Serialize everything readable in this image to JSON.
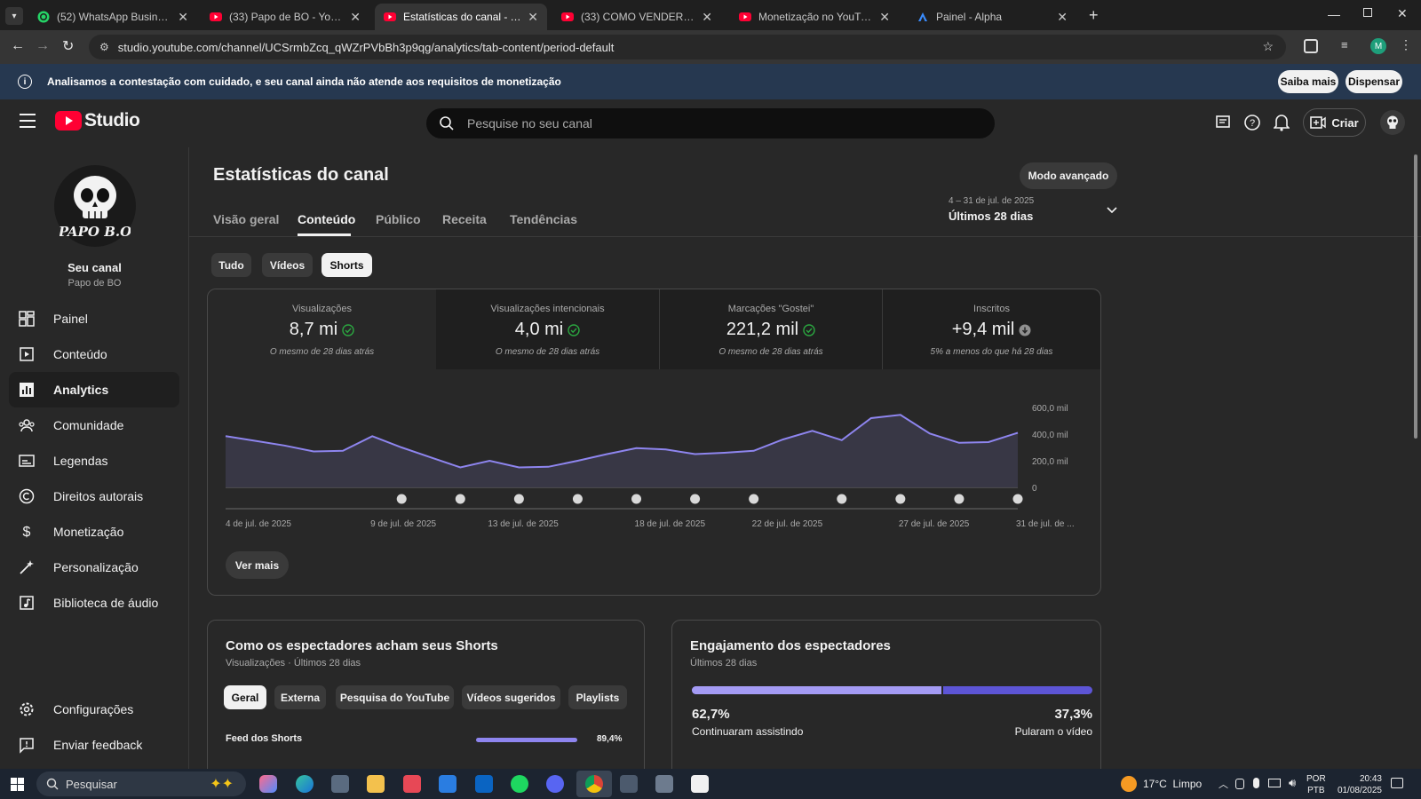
{
  "browser": {
    "tabs": [
      {
        "title": "(52) WhatsApp Business",
        "active": false
      },
      {
        "title": "(33) Papo de BO - YouTube",
        "active": false
      },
      {
        "title": "Estatísticas do canal - YouTube",
        "active": true
      },
      {
        "title": "(33) COMO VENDER E COMPRAR",
        "active": false
      },
      {
        "title": "Monetização no YouTube - You",
        "active": false
      },
      {
        "title": "Painel - Alpha",
        "active": false
      }
    ],
    "url": "studio.youtube.com/channel/UCSrmbZcq_qWZrPVbBh3p9qg/analytics/tab-content/period-default",
    "profile_letter": "M"
  },
  "banner": {
    "text": "Analisamos a contestação com cuidado, e seu canal ainda não atende aos requisitos de monetização",
    "learn_more": "Saiba mais",
    "dismiss": "Dispensar"
  },
  "header": {
    "logo_text": "Studio",
    "search_placeholder": "Pesquise no seu canal",
    "create_label": "Criar"
  },
  "sidebar": {
    "channel_label": "Seu canal",
    "channel_name": "Papo de BO",
    "items": [
      {
        "label": "Painel"
      },
      {
        "label": "Conteúdo"
      },
      {
        "label": "Analytics"
      },
      {
        "label": "Comunidade"
      },
      {
        "label": "Legendas"
      },
      {
        "label": "Direitos autorais"
      },
      {
        "label": "Monetização"
      },
      {
        "label": "Personalização"
      },
      {
        "label": "Biblioteca de áudio"
      }
    ],
    "settings": "Configurações",
    "feedback": "Enviar feedback"
  },
  "page": {
    "title": "Estatísticas do canal",
    "advanced_mode": "Modo avançado",
    "tabs": [
      "Visão geral",
      "Conteúdo",
      "Público",
      "Receita",
      "Tendências"
    ],
    "active_tab": "Conteúdo",
    "period_range": "4 – 31 de jul. de 2025",
    "period_label": "Últimos 28 dias",
    "filters": [
      "Tudo",
      "Vídeos",
      "Shorts"
    ],
    "active_filter": "Shorts"
  },
  "metrics": [
    {
      "title": "Visualizações",
      "value": "8,7 mi",
      "status": "check",
      "sub": "O mesmo de 28 dias atrás"
    },
    {
      "title": "Visualizações intencionais",
      "value": "4,0 mi",
      "status": "check",
      "sub": "O mesmo de 28 dias atrás"
    },
    {
      "title": "Marcações \"Gostei\"",
      "value": "221,2 mil",
      "status": "check",
      "sub": "O mesmo de 28 dias atrás"
    },
    {
      "title": "Inscritos",
      "value": "+9,4 mil",
      "status": "down",
      "sub": "5% a menos do que há 28 dias"
    }
  ],
  "chart_data": {
    "type": "area",
    "y_ticks": [
      "600,0 mil",
      "400,0 mil",
      "200,0 mil",
      "0"
    ],
    "ylim": [
      0,
      600000
    ],
    "x_tick_labels": [
      "4 de jul. de 2025",
      "9 de jul. de 2025",
      "13 de jul. de 2025",
      "18 de jul. de 2025",
      "22 de jul. de 2025",
      "27 de jul. de 2025",
      "31 de jul. de ..."
    ],
    "series": [
      {
        "values": [
          385000,
          350000,
          315000,
          270000,
          275000,
          385000,
          300000,
          225000,
          150000,
          200000,
          150000,
          155000,
          200000,
          250000,
          295000,
          285000,
          250000,
          260000,
          275000,
          360000,
          425000,
          355000,
          520000,
          545000,
          405000,
          335000,
          340000,
          410000
        ]
      }
    ],
    "short_markers": 13,
    "color": "#8e85ef"
  },
  "see_more": "Ver mais",
  "discovery_card": {
    "title": "Como os espectadores acham seus Shorts",
    "subtitle": "Visualizações · Últimos 28 dias",
    "chips": [
      "Geral",
      "Externa",
      "Pesquisa do YouTube",
      "Vídeos sugeridos",
      "Playlists"
    ],
    "active_chip": "Geral",
    "rows": [
      {
        "label": "Feed dos Shorts",
        "value": "89,4%",
        "fraction": 0.894
      }
    ]
  },
  "engagement_card": {
    "title": "Engajamento dos espectadores",
    "subtitle": "Últimos 28 dias",
    "stayed_pct": "62,7%",
    "stayed_label": "Continuaram assistindo",
    "skipped_pct": "37,3%",
    "skipped_label": "Pularam o vídeo",
    "stayed_fraction": 0.627
  },
  "taskbar": {
    "search_placeholder": "Pesquisar",
    "weather": "17°C  Limpo",
    "lang1": "POR",
    "lang2": "PTB",
    "time": "20:43",
    "date": "01/08/2025"
  }
}
